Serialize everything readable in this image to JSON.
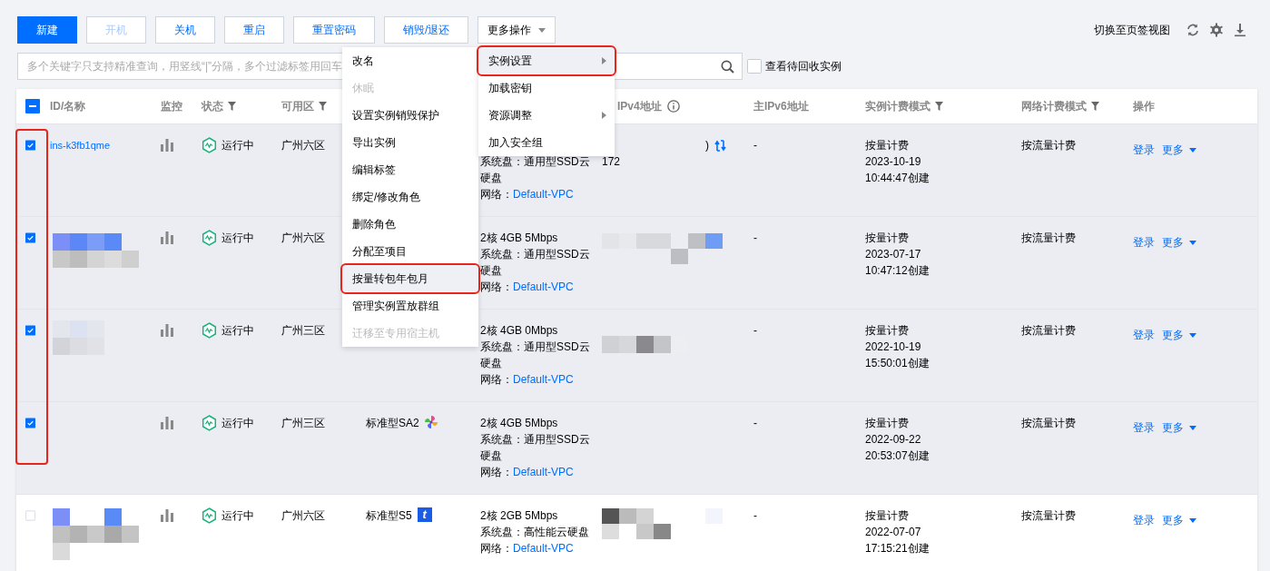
{
  "toolbar": {
    "buttons": [
      {
        "label": "新建",
        "kind": "primary",
        "disabled": false
      },
      {
        "label": "开机",
        "kind": "default",
        "disabled": true
      },
      {
        "label": "关机",
        "kind": "default",
        "disabled": false
      },
      {
        "label": "重启",
        "kind": "default",
        "disabled": false
      },
      {
        "label": "重置密码",
        "kind": "default",
        "disabled": false
      },
      {
        "label": "销毁/退还",
        "kind": "default",
        "disabled": false
      },
      {
        "label": "更多操作",
        "kind": "dropdown",
        "disabled": false
      }
    ],
    "view_switch": "切换至页签视图"
  },
  "search": {
    "placeholder": "多个关键字只支持精准查询，用竖线“|”分隔，多个过滤标签用回车"
  },
  "recycle_filter": {
    "label": "查看待回收实例",
    "checked": false
  },
  "table": {
    "select_all": {
      "indeterminate": true
    },
    "columns": [
      {
        "label": "ID/名称",
        "filter": false,
        "info": false
      },
      {
        "label": "监控",
        "filter": false,
        "info": false
      },
      {
        "label": "状态",
        "filter": true,
        "info": false
      },
      {
        "label": "可用区",
        "filter": true,
        "info": false
      },
      {
        "label": "IPv4地址",
        "filter": false,
        "info": true
      },
      {
        "label": "主IPv6地址",
        "filter": false,
        "info": false
      },
      {
        "label": "实例计费模式",
        "filter": true,
        "info": false
      },
      {
        "label": "网络计费模式",
        "filter": true,
        "info": false
      },
      {
        "label": "操作",
        "filter": false,
        "info": false
      }
    ],
    "rows": [
      {
        "selected": true,
        "id": "ins-k3fb1qme",
        "status": "运行中",
        "zone": "广州六区",
        "config": {
          "disk": "系统盘：通用型SSD云硬盘",
          "network_label": "网络：",
          "network": "Default-VPC"
        },
        "ipv4": {
          "tail": ")",
          "switch_icon": true,
          "second_line": "172"
        },
        "ipv6": "-",
        "billing": [
          "按量计费",
          "2023-10-19",
          "10:44:47创建"
        ],
        "network_billing": "按流量计费",
        "actions": [
          "登录",
          "更多"
        ]
      },
      {
        "selected": true,
        "status": "运行中",
        "zone": "广州六区",
        "config": {
          "spec": "2核 4GB 5Mbps",
          "disk": "系统盘：通用型SSD云硬盘",
          "network_label": "网络：",
          "network": "Default-VPC"
        },
        "ipv6": "-",
        "billing": [
          "按量计费",
          "2023-07-17",
          "10:47:12创建"
        ],
        "network_billing": "按流量计费",
        "actions": [
          "登录",
          "更多"
        ]
      },
      {
        "selected": true,
        "status": "运行中",
        "zone": "广州三区",
        "config": {
          "spec": "2核 4GB 0Mbps",
          "disk": "系统盘：通用型SSD云硬盘",
          "network_label": "网络：",
          "network": "Default-VPC"
        },
        "ipv6": "-",
        "billing": [
          "按量计费",
          "2022-10-19",
          "15:50:01创建"
        ],
        "network_billing": "按流量计费",
        "actions": [
          "登录",
          "更多"
        ]
      },
      {
        "selected": true,
        "status": "运行中",
        "zone": "广州三区",
        "instance_type": "标准型SA2",
        "type_badge": {
          "kind": "pinwheel"
        },
        "config": {
          "spec": "2核 4GB 5Mbps",
          "disk": "系统盘：通用型SSD云硬盘",
          "network_label": "网络：",
          "network": "Default-VPC"
        },
        "ipv6": "-",
        "billing": [
          "按量计费",
          "2022-09-22",
          "20:53:07创建"
        ],
        "network_billing": "按流量计费",
        "actions": [
          "登录",
          "更多"
        ]
      },
      {
        "selected": false,
        "status": "运行中",
        "zone": "广州六区",
        "instance_type": "标准型S5",
        "type_badge": {
          "kind": "letter",
          "text": "t"
        },
        "config": {
          "spec": "2核 2GB 5Mbps",
          "disk": "系统盘：高性能云硬盘",
          "network_label": "网络：",
          "network": "Default-VPC"
        },
        "ipv6": "-",
        "billing": [
          "按量计费",
          "2022-07-07",
          "17:15:21创建"
        ],
        "network_billing": "按流量计费",
        "actions": [
          "登录",
          "更多"
        ]
      }
    ]
  },
  "instance_settings_submenu": {
    "items": [
      {
        "label": "改名",
        "disabled": false,
        "highlighted": false,
        "annotated": false
      },
      {
        "label": "休眠",
        "disabled": true,
        "highlighted": false,
        "annotated": false
      },
      {
        "label": "设置实例销毁保护",
        "disabled": false,
        "highlighted": false,
        "annotated": false
      },
      {
        "label": "导出实例",
        "disabled": false,
        "highlighted": false,
        "annotated": false
      },
      {
        "label": "编辑标签",
        "disabled": false,
        "highlighted": false,
        "annotated": false
      },
      {
        "label": "绑定/修改角色",
        "disabled": false,
        "highlighted": false,
        "annotated": false
      },
      {
        "label": "删除角色",
        "disabled": false,
        "highlighted": false,
        "annotated": false
      },
      {
        "label": "分配至项目",
        "disabled": false,
        "highlighted": false,
        "annotated": false
      },
      {
        "label": "按量转包年包月",
        "disabled": false,
        "highlighted": true,
        "annotated": true
      },
      {
        "label": "管理实例置放群组",
        "disabled": false,
        "highlighted": false,
        "annotated": false
      },
      {
        "label": "迁移至专用宿主机",
        "disabled": true,
        "highlighted": false,
        "annotated": false
      }
    ]
  },
  "more_menu": {
    "items": [
      {
        "label": "实例设置",
        "submenu": true,
        "highlighted": true,
        "annotated": true
      },
      {
        "label": "加载密钥",
        "submenu": false,
        "highlighted": false,
        "annotated": false
      },
      {
        "label": "资源调整",
        "submenu": true,
        "highlighted": false,
        "annotated": false
      },
      {
        "label": "加入安全组",
        "submenu": false,
        "highlighted": false,
        "annotated": false
      }
    ]
  }
}
